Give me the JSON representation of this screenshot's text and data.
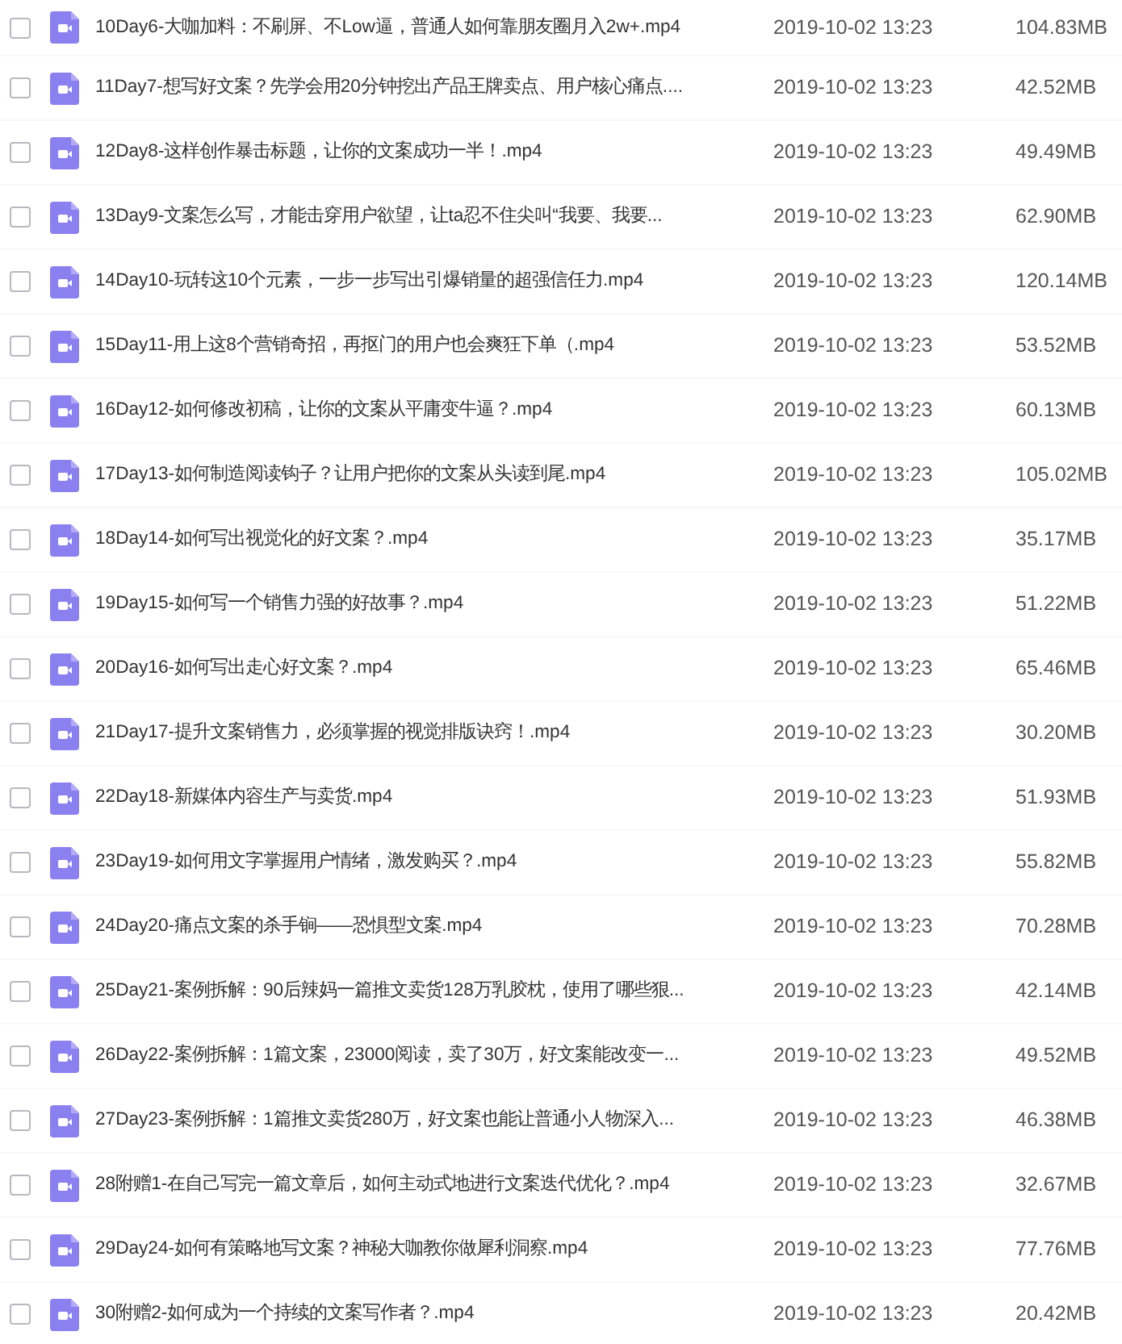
{
  "files": [
    {
      "name": "10Day6-大咖加料：不刷屏、不Low逼，普通人如何靠朋友圈月入2w+.mp4",
      "date": "2019-10-02 13:23",
      "size": "104.83MB",
      "checked": false
    },
    {
      "name": "11Day7-想写好文案？先学会用20分钟挖出产品王牌卖点、用户核心痛点....",
      "date": "2019-10-02 13:23",
      "size": "42.52MB",
      "checked": false
    },
    {
      "name": "12Day8-这样创作暴击标题，让你的文案成功一半！.mp4",
      "date": "2019-10-02 13:23",
      "size": "49.49MB",
      "checked": false
    },
    {
      "name": "13Day9-文案怎么写，才能击穿用户欲望，让ta忍不住尖叫“我要、我要...",
      "date": "2019-10-02 13:23",
      "size": "62.90MB",
      "checked": false
    },
    {
      "name": "14Day10-玩转这10个元素，一步一步写出引爆销量的超强信任力.mp4",
      "date": "2019-10-02 13:23",
      "size": "120.14MB",
      "checked": false
    },
    {
      "name": "15Day11-用上这8个营销奇招，再抠门的用户也会爽狂下单（.mp4",
      "date": "2019-10-02 13:23",
      "size": "53.52MB",
      "checked": false
    },
    {
      "name": "16Day12-如何修改初稿，让你的文案从平庸变牛逼？.mp4",
      "date": "2019-10-02 13:23",
      "size": "60.13MB",
      "checked": false
    },
    {
      "name": "17Day13-如何制造阅读钩子？让用户把你的文案从头读到尾.mp4",
      "date": "2019-10-02 13:23",
      "size": "105.02MB",
      "checked": false
    },
    {
      "name": "18Day14-如何写出视觉化的好文案？.mp4",
      "date": "2019-10-02 13:23",
      "size": "35.17MB",
      "checked": false
    },
    {
      "name": "19Day15-如何写一个销售力强的好故事？.mp4",
      "date": "2019-10-02 13:23",
      "size": "51.22MB",
      "checked": false
    },
    {
      "name": "20Day16-如何写出走心好文案？.mp4",
      "date": "2019-10-02 13:23",
      "size": "65.46MB",
      "checked": false
    },
    {
      "name": "21Day17-提升文案销售力，必须掌握的视觉排版诀窍！.mp4",
      "date": "2019-10-02 13:23",
      "size": "30.20MB",
      "checked": false
    },
    {
      "name": "22Day18-新媒体内容生产与卖货.mp4",
      "date": "2019-10-02 13:23",
      "size": "51.93MB",
      "checked": false
    },
    {
      "name": "23Day19-如何用文字掌握用户情绪，激发购买？.mp4",
      "date": "2019-10-02 13:23",
      "size": "55.82MB",
      "checked": false
    },
    {
      "name": "24Day20-痛点文案的杀手锏——恐惧型文案.mp4",
      "date": "2019-10-02 13:23",
      "size": "70.28MB",
      "checked": false
    },
    {
      "name": "25Day21-案例拆解：90后辣妈一篇推文卖货128万乳胶枕，使用了哪些狠...",
      "date": "2019-10-02 13:23",
      "size": "42.14MB",
      "checked": false
    },
    {
      "name": "26Day22-案例拆解：1篇文案，23000阅读，卖了30万，好文案能改变一...",
      "date": "2019-10-02 13:23",
      "size": "49.52MB",
      "checked": false
    },
    {
      "name": "27Day23-案例拆解：1篇推文卖货280万，好文案也能让普通小人物深入...",
      "date": "2019-10-02 13:23",
      "size": "46.38MB",
      "checked": false
    },
    {
      "name": "28附赠1-在自己写完一篇文章后，如何主动式地进行文案迭代优化？.mp4",
      "date": "2019-10-02 13:23",
      "size": "32.67MB",
      "checked": false
    },
    {
      "name": "29Day24-如何有策略地写文案？神秘大咖教你做犀利洞察.mp4",
      "date": "2019-10-02 13:23",
      "size": "77.76MB",
      "checked": false
    },
    {
      "name": "30附赠2-如何成为一个持续的文案写作者？.mp4",
      "date": "2019-10-02 13:23",
      "size": "20.42MB",
      "checked": false
    }
  ]
}
